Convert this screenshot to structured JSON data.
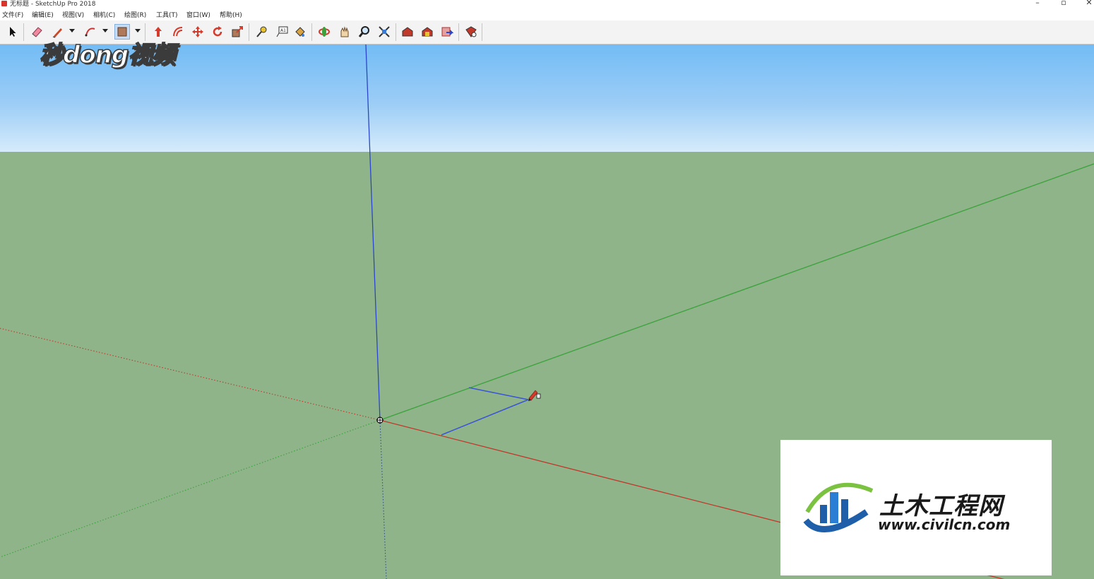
{
  "window": {
    "title": "无标题 - SketchUp Pro 2018",
    "minimize": "–",
    "maximize": "▫",
    "close": "✕"
  },
  "menu": {
    "items": [
      {
        "label": "文件(F)"
      },
      {
        "label": "编辑(E)"
      },
      {
        "label": "视图(V)"
      },
      {
        "label": "相机(C)"
      },
      {
        "label": "绘图(R)"
      },
      {
        "label": "工具(T)"
      },
      {
        "label": "窗口(W)"
      },
      {
        "label": "帮助(H)"
      }
    ]
  },
  "toolbar": {
    "tools": [
      {
        "icon": "select-arrow-icon"
      },
      {
        "icon": "eraser-icon"
      },
      {
        "icon": "pencil-line-icon"
      },
      {
        "icon": "arc-icon"
      },
      {
        "icon": "rectangle-shape-icon",
        "active": true
      },
      {
        "icon": "push-pull-icon"
      },
      {
        "icon": "offset-icon"
      },
      {
        "icon": "move-icon"
      },
      {
        "icon": "rotate-icon"
      },
      {
        "icon": "scale-icon"
      },
      {
        "icon": "tape-measure-icon"
      },
      {
        "icon": "text-icon"
      },
      {
        "icon": "paint-bucket-icon"
      },
      {
        "icon": "orbit-icon"
      },
      {
        "icon": "pan-icon"
      },
      {
        "icon": "zoom-icon"
      },
      {
        "icon": "zoom-extents-icon"
      },
      {
        "icon": "warehouse-icon"
      },
      {
        "icon": "extension-warehouse-icon"
      },
      {
        "icon": "send-to-layout-icon"
      },
      {
        "icon": "extension-manager-icon"
      }
    ]
  },
  "colors": {
    "sky_top": "#72bcf5",
    "ground": "#8fb48a",
    "red_axis": "#c0392b",
    "green_axis": "#3aa23a",
    "blue_axis": "#2b46c8",
    "drawn_edge": "#3b55d6"
  },
  "watermarks": {
    "video": "秒dong视频",
    "civil_cn": "土木工程网",
    "civil_url": "www.civilcn.com"
  }
}
